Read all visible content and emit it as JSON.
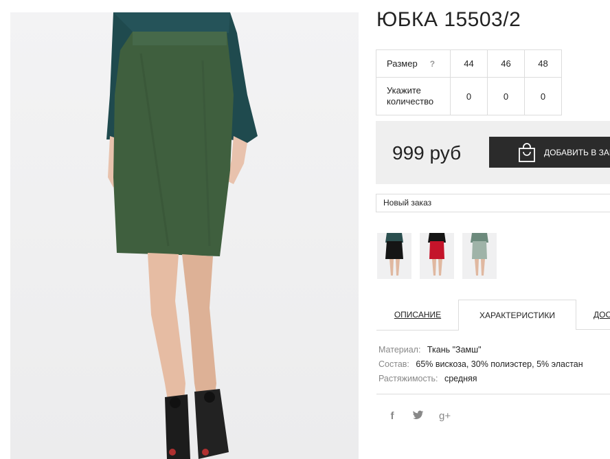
{
  "product": {
    "title": "ЮБКА 15503/2"
  },
  "sizes": {
    "size_label": "Размер",
    "help": "?",
    "qty_label_1": "Укажите",
    "qty_label_2": "количество",
    "columns": [
      "44",
      "46",
      "48"
    ],
    "quantities": [
      "0",
      "0",
      "0"
    ]
  },
  "price": {
    "value": "999 руб"
  },
  "cart": {
    "add_label": "ДОБАВИТЬ В ЗАКАЗ"
  },
  "order_select": {
    "value": "Новый заказ"
  },
  "tabs": {
    "description": "ОПИСАНИЕ",
    "characteristics": "ХАРАКТЕРИСТИКИ",
    "delivery": "ДОСТАВКА"
  },
  "specs": {
    "material_key": "Материал:",
    "material_val": "Ткань \"Замш\"",
    "composition_key": "Состав:",
    "composition_val": "65% вискоза, 30% полиэстер, 5% эластан",
    "stretch_key": "Растяжимость:",
    "stretch_val": "средняя"
  },
  "social": {
    "facebook": "f",
    "twitter": "t",
    "google": "g+"
  },
  "colors": {
    "skirt": "#3f5f3e",
    "blouse": "#1f4a4e",
    "button": "#2b2b2b"
  },
  "icons": [
    "bag-icon",
    "facebook-icon",
    "twitter-icon",
    "google-plus-icon"
  ]
}
